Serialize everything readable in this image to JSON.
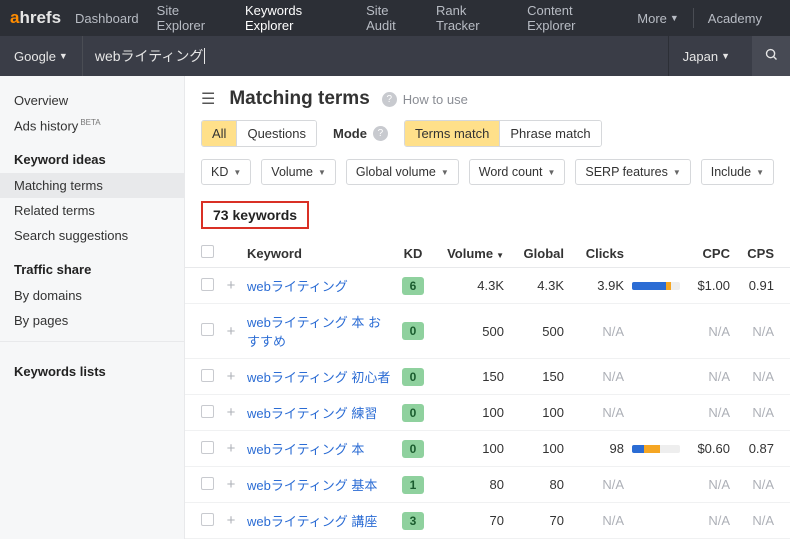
{
  "logo": {
    "a": "a",
    "hrefs": "hrefs"
  },
  "nav": {
    "items": [
      "Dashboard",
      "Site Explorer",
      "Keywords Explorer",
      "Site Audit",
      "Rank Tracker",
      "Content Explorer"
    ],
    "more": "More",
    "academy": "Academy",
    "active_index": 2
  },
  "search": {
    "engine": "Google",
    "keyword": "webライティング",
    "country": "Japan"
  },
  "sidebar": {
    "top": [
      "Overview",
      "Ads history"
    ],
    "beta": "BETA",
    "ideas_header": "Keyword ideas",
    "ideas": [
      "Matching terms",
      "Related terms",
      "Search suggestions"
    ],
    "ideas_active": 0,
    "traffic_header": "Traffic share",
    "traffic": [
      "By domains",
      "By pages"
    ],
    "lists_header": "Keywords lists"
  },
  "page": {
    "title": "Matching terms",
    "howto": "How to use"
  },
  "tabs": {
    "group1": [
      "All",
      "Questions"
    ],
    "group1_sel": 0,
    "mode_label": "Mode",
    "group2": [
      "Terms match",
      "Phrase match"
    ],
    "group2_sel": 0
  },
  "filters": [
    "KD",
    "Volume",
    "Global volume",
    "Word count",
    "SERP features",
    "Include"
  ],
  "count": "73 keywords",
  "columns": {
    "keyword": "Keyword",
    "kd": "KD",
    "volume": "Volume",
    "global": "Global",
    "clicks": "Clicks",
    "cpc": "CPC",
    "cps": "CPS"
  },
  "rows": [
    {
      "kw": "webライティング",
      "kd": "6",
      "vol": "4.3K",
      "glob": "4.3K",
      "clicks": "3.9K",
      "bar_blue": 70,
      "bar_orange": 12,
      "cpc": "$1.00",
      "cps": "0.91"
    },
    {
      "kw": "webライティング 本 おすすめ",
      "kd": "0",
      "vol": "500",
      "glob": "500",
      "clicks": "N/A",
      "cpc": "N/A",
      "cps": "N/A"
    },
    {
      "kw": "webライティング 初心者",
      "kd": "0",
      "vol": "150",
      "glob": "150",
      "clicks": "N/A",
      "cpc": "N/A",
      "cps": "N/A"
    },
    {
      "kw": "webライティング 練習",
      "kd": "0",
      "vol": "100",
      "glob": "100",
      "clicks": "N/A",
      "cpc": "N/A",
      "cps": "N/A"
    },
    {
      "kw": "webライティング 本",
      "kd": "0",
      "vol": "100",
      "glob": "100",
      "clicks": "98",
      "bar_blue": 24,
      "bar_orange": 34,
      "cpc": "$0.60",
      "cps": "0.87"
    },
    {
      "kw": "webライティング 基本",
      "kd": "1",
      "vol": "80",
      "glob": "80",
      "clicks": "N/A",
      "cpc": "N/A",
      "cps": "N/A"
    },
    {
      "kw": "webライティング 講座",
      "kd": "3",
      "vol": "70",
      "glob": "70",
      "clicks": "N/A",
      "cpc": "N/A",
      "cps": "N/A"
    }
  ]
}
